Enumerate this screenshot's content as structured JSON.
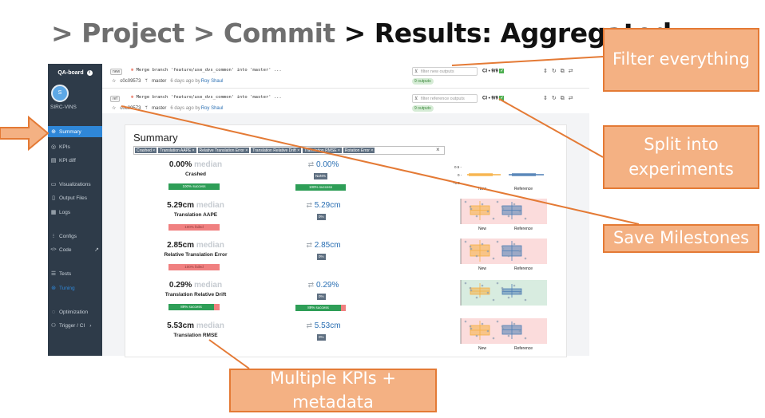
{
  "header": {
    "breadcrumb_prefix": "> Project > Commit ",
    "breadcrumb_current": "> Results: Aggregated"
  },
  "sidebar": {
    "app_title": "QA-board",
    "avatar_letter": "S",
    "project": "SIRC-VINS",
    "items": [
      {
        "label": "Summary",
        "icon": "⊕"
      },
      {
        "label": "KPIs",
        "icon": "◎"
      },
      {
        "label": "KPI diff",
        "icon": "▤"
      },
      {
        "label": "Visualizations",
        "icon": "▭"
      },
      {
        "label": "Output Files",
        "icon": "▯"
      },
      {
        "label": "Logs",
        "icon": "▦"
      },
      {
        "label": "Configs",
        "icon": "⁝"
      },
      {
        "label": "Code",
        "icon": "</>"
      },
      {
        "label": "Tests",
        "icon": "☰"
      },
      {
        "label": "Tuning",
        "icon": "⊛"
      },
      {
        "label": "Optimization",
        "icon": "◌"
      },
      {
        "label": "Trigger / CI",
        "icon": "⚇"
      }
    ]
  },
  "commits": [
    {
      "tag": "new",
      "message": "Merge branch 'feature/use_dvs_common' into 'master' ...",
      "hash": "c0c09573",
      "branch": "master",
      "time": "6 days ago by",
      "author": "Roy Shaul",
      "filter_placeholder": "filter new outputs",
      "outputs": "9 outputs",
      "ci": "CI • 9/9"
    },
    {
      "tag": "ref",
      "message": "Merge branch 'feature/use_dvs_common' into 'master' ...",
      "hash": "c0c09573",
      "branch": "master",
      "time": "6 days ago by",
      "author": "Roy Shaul",
      "filter_placeholder": "filter reference outputs",
      "outputs": "9 outputs",
      "ci": "CI • 9/9"
    }
  ],
  "summary": {
    "title": "Summary",
    "chips": [
      "Crashed ×",
      "Translation AAPE ×",
      "Relative Translation Error ×",
      "Translation Relative Drift ×",
      "Translation RMSE ×",
      "Rotation Error ×"
    ],
    "clear": "×",
    "median_label": "median",
    "plot_new": "New",
    "plot_ref": "Reference",
    "kpis": [
      {
        "value": "0.00%",
        "name": "Crashed",
        "bar": "100% success",
        "bar_color": "#2e9e57",
        "ref_value": "0.00%",
        "badge": "NaN%",
        "ref_bar": "100% success"
      },
      {
        "value": "5.29cm",
        "name": "Translation AAPE",
        "bar": "100% failed",
        "bar_color": "#f08080",
        "ref_value": "5.29cm",
        "badge": "0%"
      },
      {
        "value": "2.85cm",
        "name": "Relative Translation Error",
        "bar": "100% failed",
        "bar_color": "#f08080",
        "ref_value": "2.85cm",
        "badge": "0%"
      },
      {
        "value": "0.29%",
        "name": "Translation Relative Drift",
        "bar": "89% success",
        "bar_color": "#2e9e57",
        "ref_value": "0.29%",
        "badge": "0%",
        "ref_bar": "89% success"
      },
      {
        "value": "5.53cm",
        "name": "Translation RMSE",
        "ref_value": "5.53cm",
        "badge": "0%"
      }
    ],
    "crashed_ticks": [
      "0.5 -",
      "0 -",
      "−0.5 -"
    ]
  },
  "annotations": {
    "filter": "Filter everything",
    "split": "Split into experiments",
    "milestones": "Save Milestones",
    "multiple": "Multiple KPIs + metadata"
  },
  "colors": {
    "sidebar": "#2e3b49",
    "active": "#2f87d8",
    "callout_fill": "#f4b183",
    "callout_border": "#e47a35",
    "new_box": "#f6b044",
    "ref_box": "#4f7fb5"
  }
}
